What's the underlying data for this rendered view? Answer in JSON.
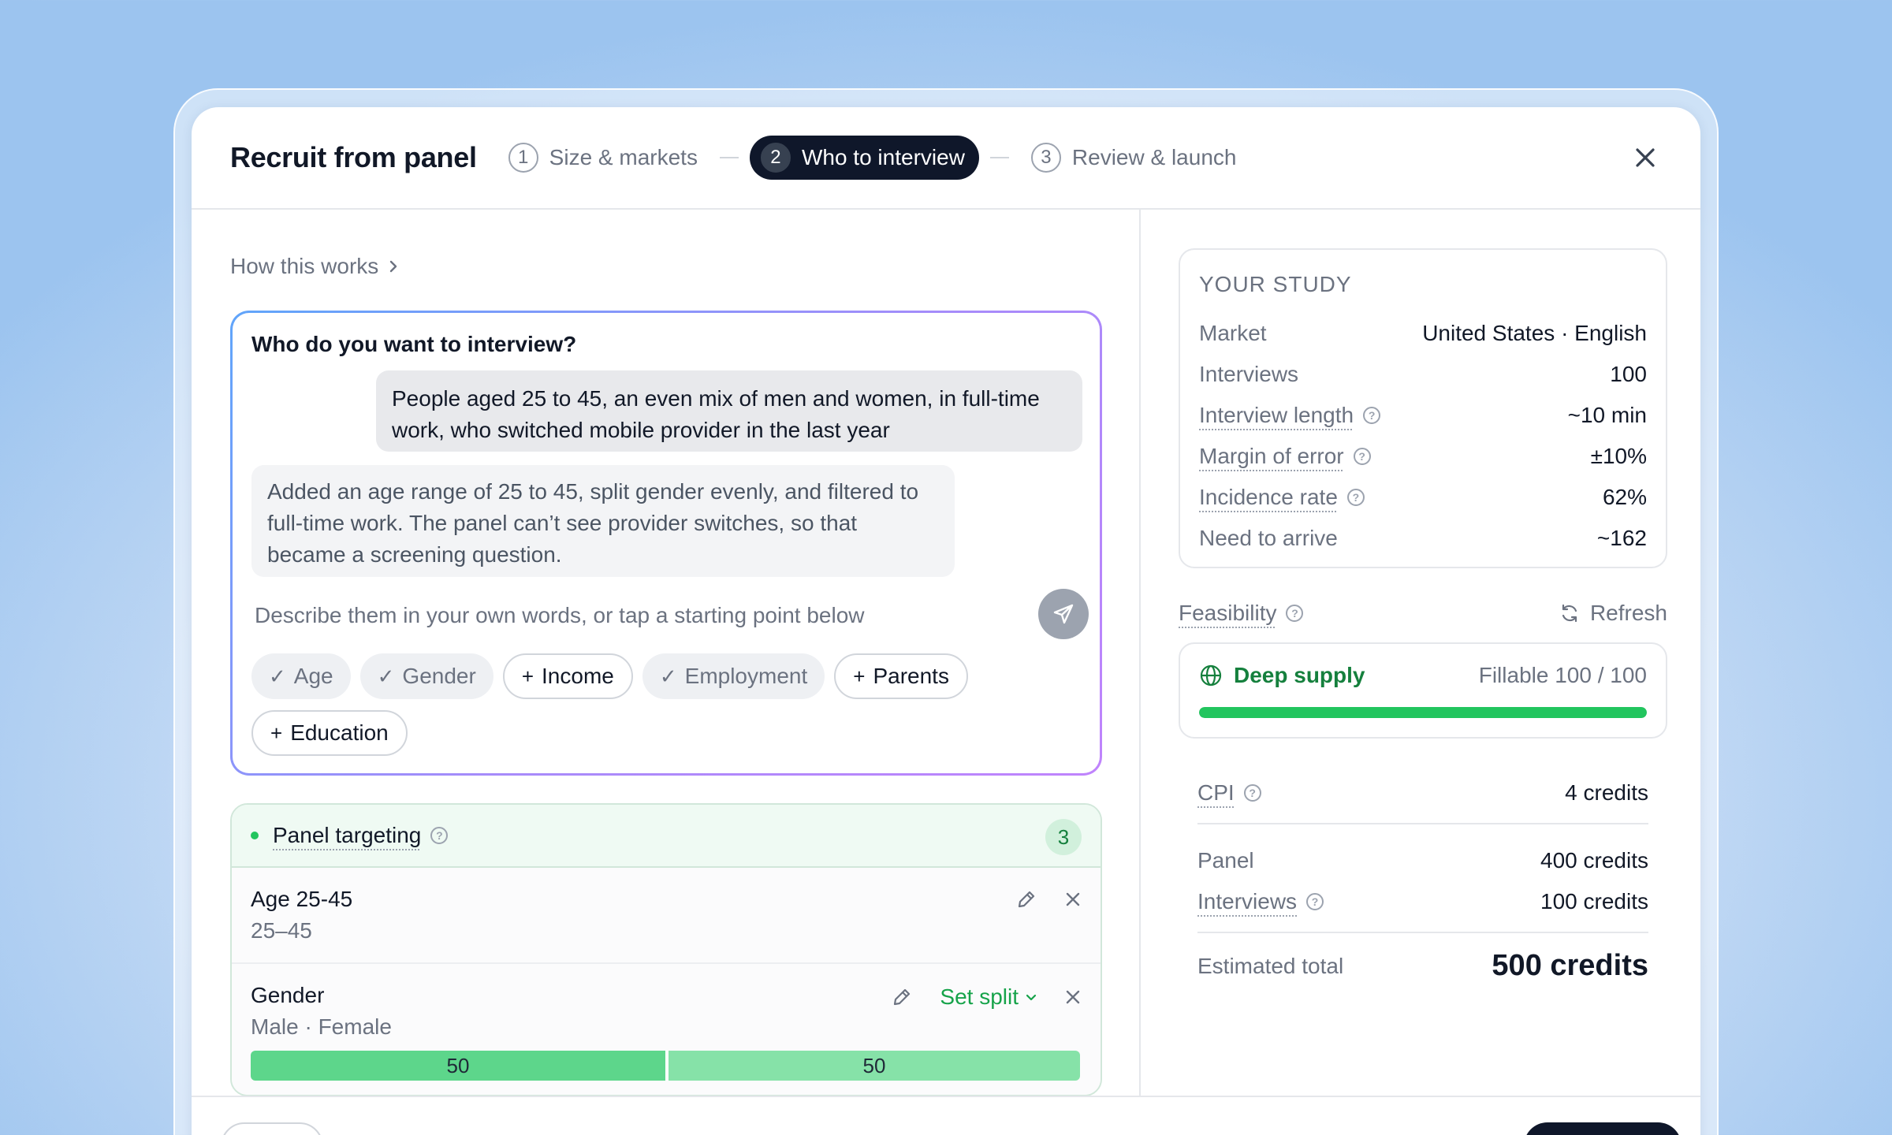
{
  "modal": {
    "title": "Recruit from panel"
  },
  "steps": [
    {
      "num": "1",
      "label": "Size & markets"
    },
    {
      "num": "2",
      "label": "Who to interview"
    },
    {
      "num": "3",
      "label": "Review & launch"
    }
  ],
  "how_link": "How this works",
  "chat": {
    "question": "Who do you want to interview?",
    "user_message": "People aged 25 to 45, an even mix of men and women, in full-time work, who switched mobile provider in the last year",
    "assistant_message": "Added an age range of 25 to 45, split gender evenly, and filtered to full-time work. The panel can’t see provider switches, so that became a screening question.",
    "input_placeholder": "Describe them in your own words, or tap a starting point below",
    "chips": [
      {
        "label": "Age",
        "state": "selected"
      },
      {
        "label": "Gender",
        "state": "selected"
      },
      {
        "label": "Income",
        "state": "add"
      },
      {
        "label": "Employment",
        "state": "selected"
      },
      {
        "label": "Parents",
        "state": "add"
      },
      {
        "label": "Education",
        "state": "add"
      }
    ]
  },
  "targeting": {
    "title": "Panel targeting",
    "count": "3",
    "rows": [
      {
        "label": "Age 25-45",
        "sub": "25–45"
      },
      {
        "label": "Gender",
        "sub": "Male · Female",
        "set_split": "Set split",
        "split": [
          50,
          50
        ]
      }
    ]
  },
  "study": {
    "heading": "YOUR STUDY",
    "rows": [
      {
        "k": "Market",
        "v": "United States · English"
      },
      {
        "k": "Interviews",
        "v": "100"
      },
      {
        "k": "Interview length",
        "v": "~10 min"
      },
      {
        "k": "Margin of error",
        "v": "±10%"
      },
      {
        "k": "Incidence rate",
        "v": "62%"
      },
      {
        "k": "Need to arrive",
        "v": "~162"
      }
    ]
  },
  "feasibility": {
    "label": "Feasibility",
    "refresh": "Refresh",
    "status": "Deep supply",
    "fillable": "Fillable 100 / 100",
    "fill_fraction": 1.0
  },
  "cost": {
    "cpi_label": "CPI",
    "cpi_value": "4 credits",
    "panel_label": "Panel",
    "panel_value": "400 credits",
    "interviews_label": "Interviews",
    "interviews_value": "100 credits",
    "total_label": "Estimated total",
    "total_value": "500 credits"
  },
  "colors": {
    "accent_green": "#22c55e",
    "dark": "#0f172a"
  }
}
